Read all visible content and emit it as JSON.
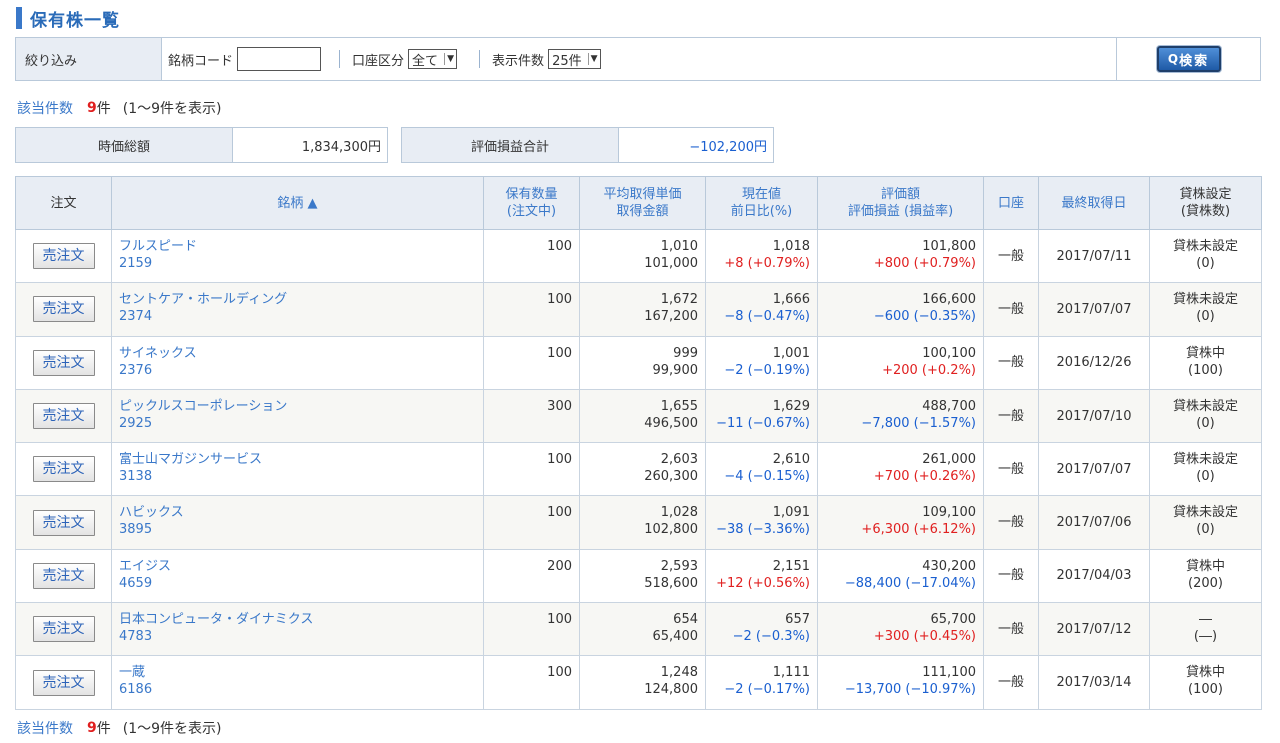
{
  "page": {
    "title": "保有株一覧"
  },
  "filter": {
    "label": "絞り込み",
    "code_label": "銘柄コード",
    "code_value": "",
    "account_label": "口座区分",
    "account_value": "全て",
    "display_label": "表示件数",
    "display_value": "25件",
    "search_icon": "magnifier-icon",
    "search_label": "検索"
  },
  "count": {
    "key": "該当件数",
    "number": "9",
    "unit": "件",
    "range": "(1～9件を表示)"
  },
  "summary": {
    "market_value_label": "時価総額",
    "market_value": "1,834,300円",
    "pl_total_label": "評価損益合計",
    "pl_total": "−102,200円"
  },
  "table": {
    "headers": {
      "order": "注文",
      "name": "銘柄 ▲",
      "qty_1": "保有数量",
      "qty_2": "(注文中)",
      "avg_1": "平均取得単価",
      "avg_2": "取得金額",
      "price_1": "現在値",
      "price_2": "前日比(%)",
      "eval_1": "評価額",
      "eval_2": "評価損益 (損益率)",
      "account": "口座",
      "last": "最終取得日",
      "lend_1": "貸株設定",
      "lend_2": "(貸株数)"
    },
    "sell_label": "売注文",
    "colors": {
      "up": "#e02020",
      "down": "#1a5fd0"
    },
    "rows": [
      {
        "name": "フルスピード",
        "code": "2159",
        "qty": "100",
        "avg": "1,010",
        "cost": "101,000",
        "price": "1,018",
        "change": "+8 (+0.79%)",
        "dir": "up",
        "eval": "101,800",
        "pl": "+800 (+0.79%)",
        "pldir": "up",
        "account": "一般",
        "date": "2017/07/11",
        "lend": "貸株未設定",
        "lend_qty": "(0)"
      },
      {
        "name": "セントケア・ホールディング",
        "code": "2374",
        "qty": "100",
        "avg": "1,672",
        "cost": "167,200",
        "price": "1,666",
        "change": "−8 (−0.47%)",
        "dir": "down",
        "eval": "166,600",
        "pl": "−600 (−0.35%)",
        "pldir": "down",
        "account": "一般",
        "date": "2017/07/07",
        "lend": "貸株未設定",
        "lend_qty": "(0)"
      },
      {
        "name": "サイネックス",
        "code": "2376",
        "qty": "100",
        "avg": "999",
        "cost": "99,900",
        "price": "1,001",
        "change": "−2 (−0.19%)",
        "dir": "down",
        "eval": "100,100",
        "pl": "+200 (+0.2%)",
        "pldir": "up",
        "account": "一般",
        "date": "2016/12/26",
        "lend": "貸株中",
        "lend_qty": "(100)"
      },
      {
        "name": "ピックルスコーポレーション",
        "code": "2925",
        "qty": "300",
        "avg": "1,655",
        "cost": "496,500",
        "price": "1,629",
        "change": "−11 (−0.67%)",
        "dir": "down",
        "eval": "488,700",
        "pl": "−7,800 (−1.57%)",
        "pldir": "down",
        "account": "一般",
        "date": "2017/07/10",
        "lend": "貸株未設定",
        "lend_qty": "(0)"
      },
      {
        "name": "富士山マガジンサービス",
        "code": "3138",
        "qty": "100",
        "avg": "2,603",
        "cost": "260,300",
        "price": "2,610",
        "change": "−4 (−0.15%)",
        "dir": "down",
        "eval": "261,000",
        "pl": "+700 (+0.26%)",
        "pldir": "up",
        "account": "一般",
        "date": "2017/07/07",
        "lend": "貸株未設定",
        "lend_qty": "(0)"
      },
      {
        "name": "ハビックス",
        "code": "3895",
        "qty": "100",
        "avg": "1,028",
        "cost": "102,800",
        "price": "1,091",
        "change": "−38 (−3.36%)",
        "dir": "down",
        "eval": "109,100",
        "pl": "+6,300 (+6.12%)",
        "pldir": "up",
        "account": "一般",
        "date": "2017/07/06",
        "lend": "貸株未設定",
        "lend_qty": "(0)"
      },
      {
        "name": "エイジス",
        "code": "4659",
        "qty": "200",
        "avg": "2,593",
        "cost": "518,600",
        "price": "2,151",
        "change": "+12 (+0.56%)",
        "dir": "up",
        "eval": "430,200",
        "pl": "−88,400 (−17.04%)",
        "pldir": "down",
        "account": "一般",
        "date": "2017/04/03",
        "lend": "貸株中",
        "lend_qty": "(200)"
      },
      {
        "name": "日本コンピュータ・ダイナミクス",
        "code": "4783",
        "qty": "100",
        "avg": "654",
        "cost": "65,400",
        "price": "657",
        "change": "−2 (−0.3%)",
        "dir": "down",
        "eval": "65,700",
        "pl": "+300 (+0.45%)",
        "pldir": "up",
        "account": "一般",
        "date": "2017/07/12",
        "lend": "―",
        "lend_qty": "(―)"
      },
      {
        "name": "一蔵",
        "code": "6186",
        "qty": "100",
        "avg": "1,248",
        "cost": "124,800",
        "price": "1,111",
        "change": "−2 (−0.17%)",
        "dir": "down",
        "eval": "111,100",
        "pl": "−13,700 (−10.97%)",
        "pldir": "down",
        "account": "一般",
        "date": "2017/03/14",
        "lend": "貸株中",
        "lend_qty": "(100)"
      }
    ]
  }
}
